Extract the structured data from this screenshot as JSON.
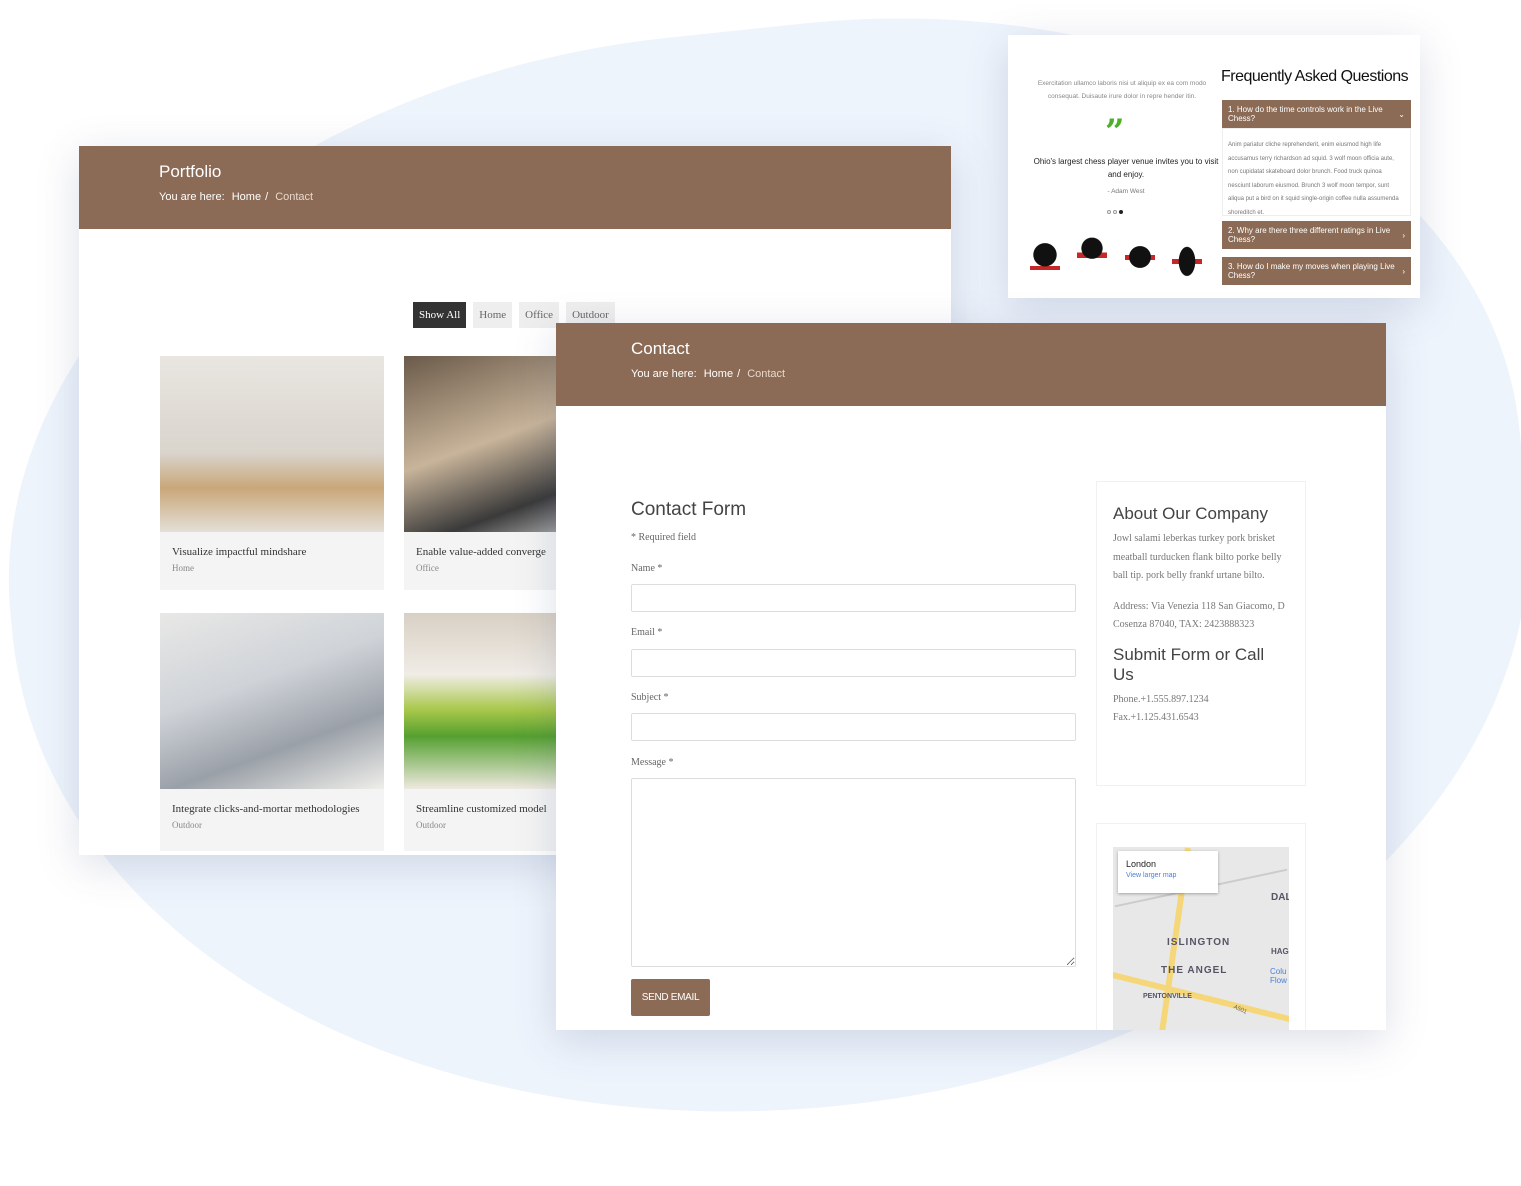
{
  "portfolio": {
    "title": "Portfolio",
    "breadcrumb": {
      "prefix": "You are here:",
      "home": "Home",
      "current": "Contact"
    },
    "filters": [
      "Show All",
      "Home",
      "Office",
      "Outdoor"
    ],
    "cards": [
      {
        "title": "Visualize impactful mindshare",
        "category": "Home"
      },
      {
        "title": "Enable value-added converge",
        "category": "Office"
      },
      {
        "title": "Integrate clicks-and-mortar methodologies",
        "category": "Outdoor"
      },
      {
        "title": "Streamline customized model",
        "category": "Outdoor"
      }
    ]
  },
  "contact": {
    "title": "Contact",
    "breadcrumb": {
      "prefix": "You are here:",
      "home": "Home",
      "current": "Contact"
    },
    "form": {
      "title": "Contact Form",
      "required_note": "* Required field",
      "name_label": "Name *",
      "email_label": "Email *",
      "subject_label": "Subject *",
      "message_label": "Message *",
      "submit": "SEND EMAIL"
    },
    "about": {
      "title": "About Our Company",
      "text": "Jowl salami leberkas turkey pork brisket meatball turducken flank bilto porke belly ball tip. pork belly frankf urtane bilto.",
      "address": "Address: Via Venezia 118 San Giacomo, D Cosenza 87040, TAX: 2423888323",
      "call_title": "Submit Form or Call Us",
      "phone": "Phone.+1.555.897.1234",
      "fax": "Fax.+1.125.431.6543"
    },
    "map": {
      "place": "London",
      "link": "View larger map",
      "labels": [
        "ISLINGTON",
        "THE ANGEL",
        "PENTONVILLE",
        "DAL",
        "HAGG",
        "Colu Flow",
        "A501"
      ]
    }
  },
  "faq": {
    "intro": "Exercitation ullamco laboris nisi ut aliquip ex ea com modo consequat. Duisaute irure dolor in repre hender itin.",
    "quote": "Ohio's largest chess player venue invites you to visit and enjoy.",
    "author": "- Adam West",
    "title": "Frequently Asked Questions",
    "items": [
      {
        "q": "1. How do the time controls work in the Live Chess?",
        "a": "Anim pariatur cliche reprehenderit, enim eiusmod high life accusamus terry richardson ad squid. 3 wolf moon officia aute, non cupidatat skateboard dolor brunch. Food truck quinoa nesciunt laborum eiusmod. Brunch 3 wolf moon tempor, sunt aliqua put a bird on it squid single-origin coffee nulla assumenda shoreditch et."
      },
      {
        "q": "2. Why are there three different ratings in Live Chess?"
      },
      {
        "q": "3. How do I make my moves when playing Live Chess?"
      }
    ]
  },
  "colors": {
    "brand": "#8b6b55",
    "quote_icon": "#4caf28",
    "background_blob": "#eef4fc"
  }
}
